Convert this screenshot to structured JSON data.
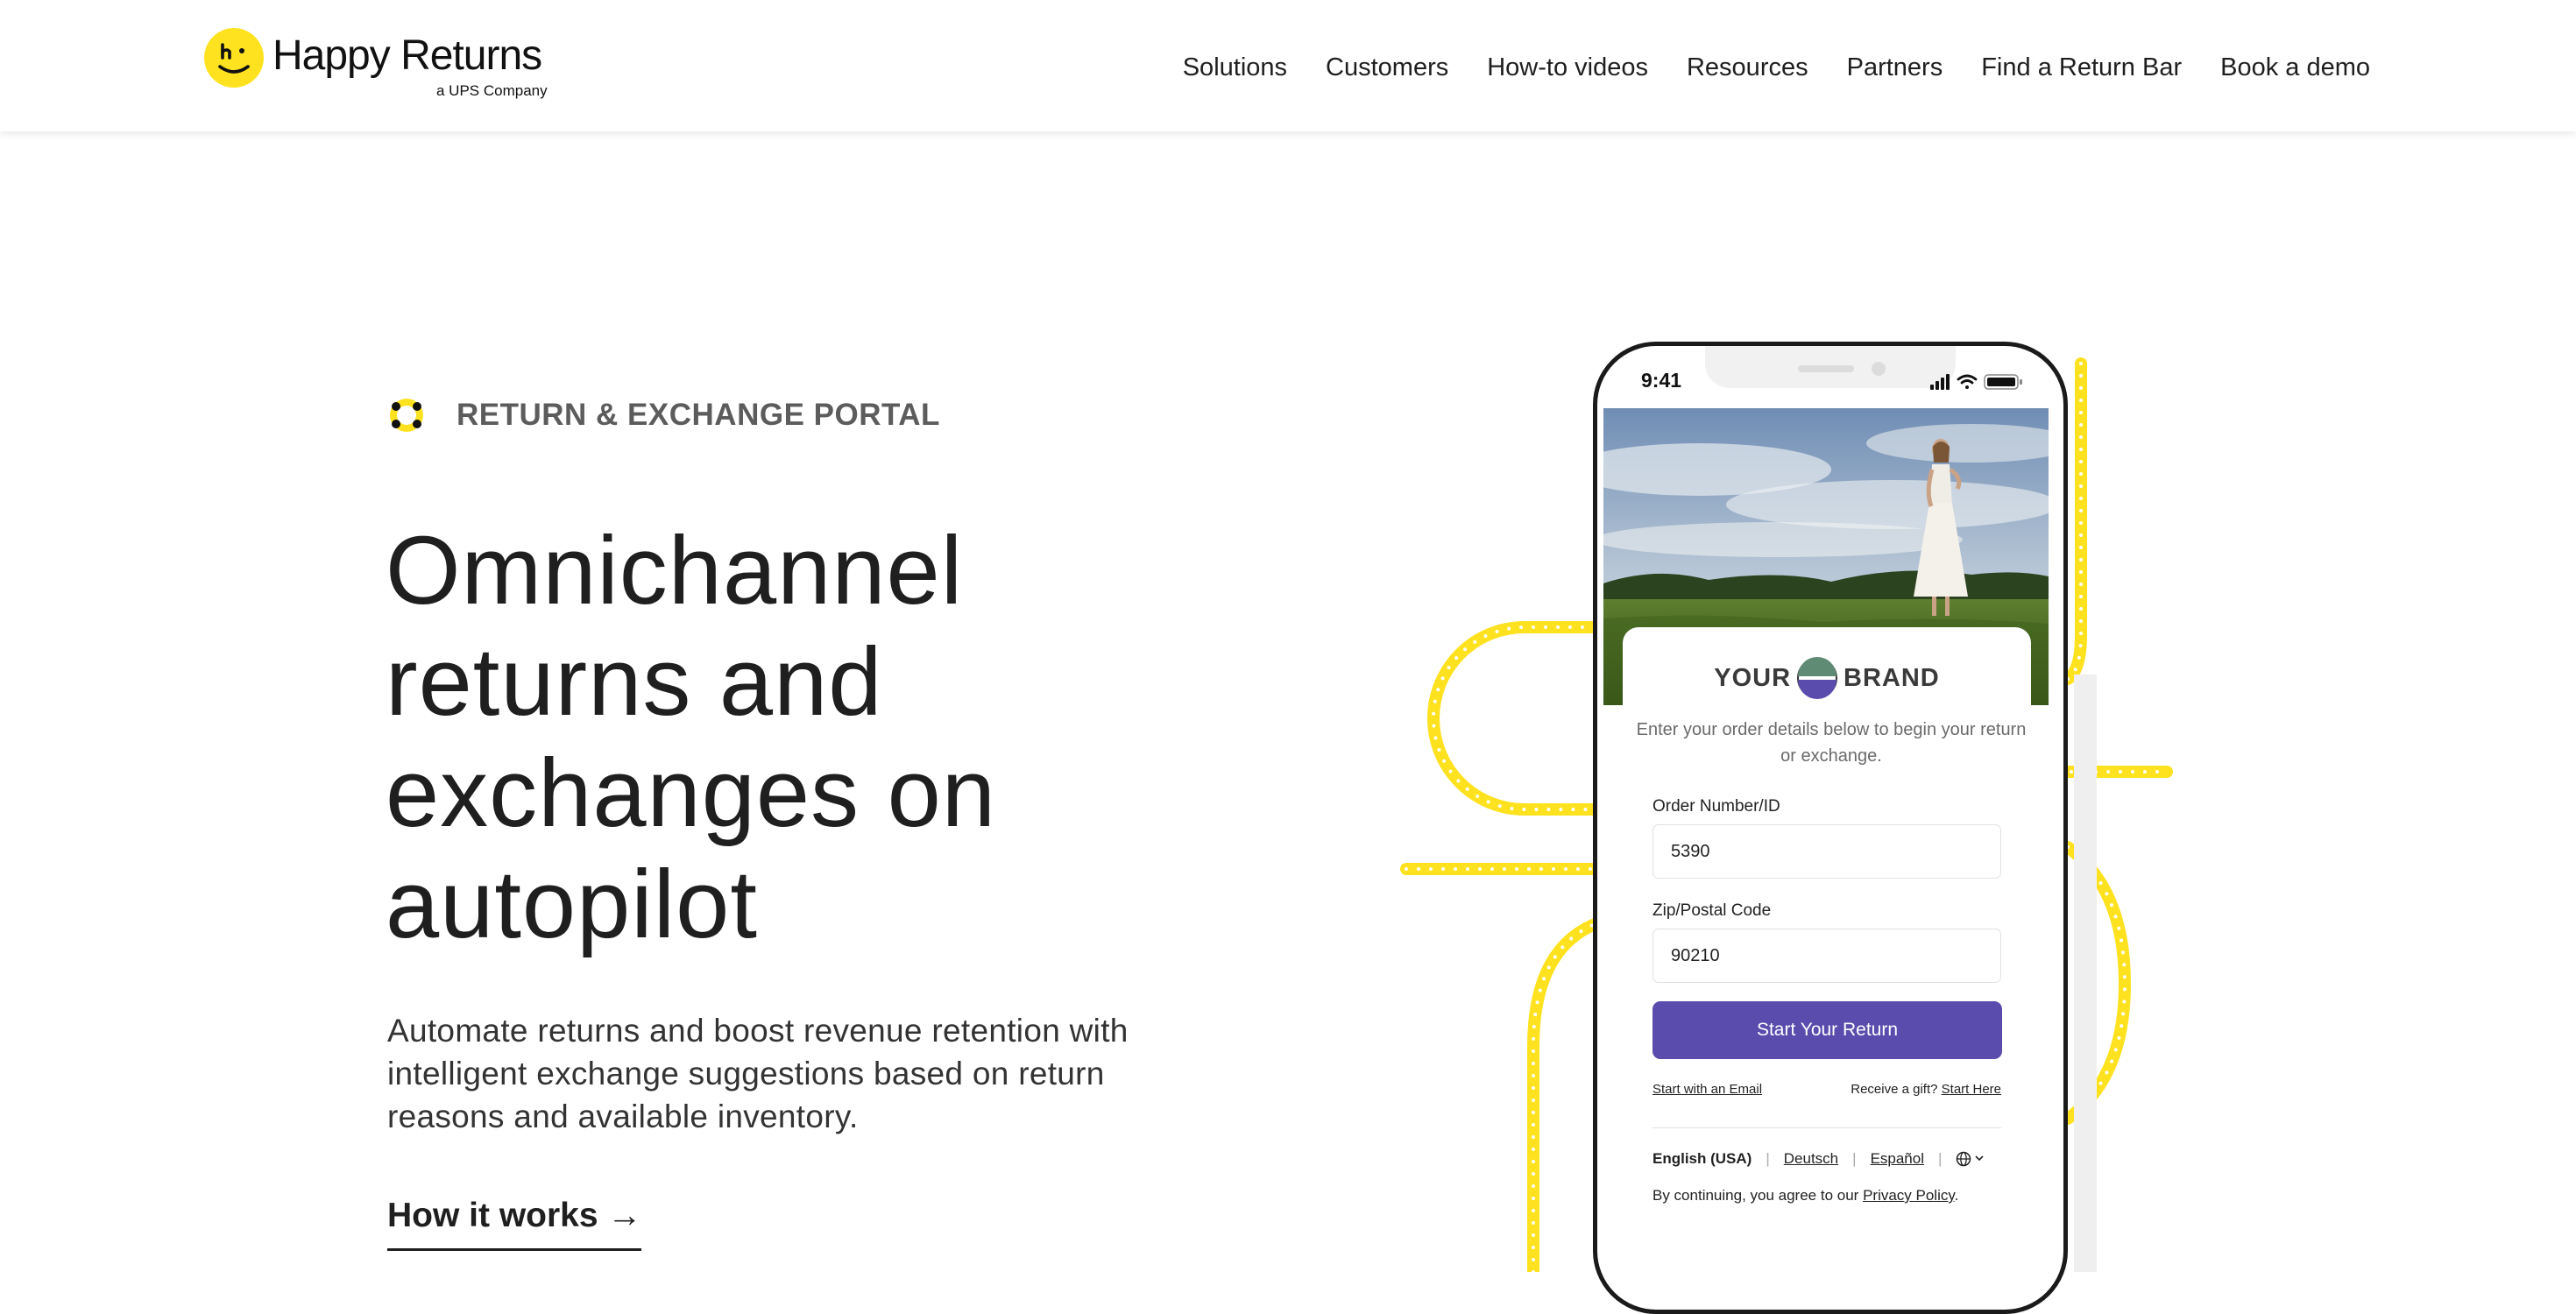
{
  "header": {
    "brand_name": "Happy Returns",
    "brand_tagline": "a UPS Company",
    "nav": [
      "Solutions",
      "Customers",
      "How-to videos",
      "Resources",
      "Partners",
      "Find a Return Bar",
      "Book a demo"
    ]
  },
  "hero": {
    "eyebrow": "RETURN & EXCHANGE PORTAL",
    "headline_lines": [
      "Omnichannel",
      "returns and",
      "exchanges on",
      "autopilot"
    ],
    "subtext": "Automate returns and boost revenue retention with intelligent exchange suggestions based on return reasons and available inventory.",
    "cta": "How it works →"
  },
  "phone": {
    "status_time": "9:41",
    "brand_left": "YOUR",
    "brand_right": "BRAND",
    "intro": "Enter your order details below to begin your return or exchange.",
    "order_label": "Order Number/ID",
    "order_value": "5390",
    "zip_label": "Zip/Postal Code",
    "zip_value": "90210",
    "start_button": "Start Your Return",
    "email_link": "Start with an Email",
    "gift_text": "Receive a gift?",
    "gift_link": "Start Here",
    "languages": [
      "English (USA)",
      "Deutsch",
      "Español"
    ],
    "consent_text": "By continuing, you agree to our",
    "privacy_link": "Privacy Policy"
  },
  "colors": {
    "brand_yellow": "#ffe21f",
    "accent_purple": "#5a4cad",
    "text_dark": "#1f1f1f",
    "eyebrow_gray": "#5c5c5c"
  },
  "icons": {
    "logo": "smiley-face-icon",
    "eyebrow": "ring-dots-icon",
    "status": [
      "signal-bars-icon",
      "wifi-icon",
      "battery-icon"
    ],
    "language": "globe-icon"
  }
}
